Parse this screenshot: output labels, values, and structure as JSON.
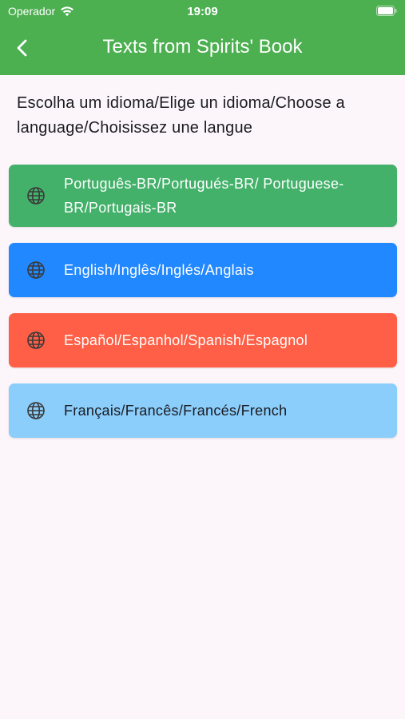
{
  "status_bar": {
    "carrier": "Operador",
    "time": "19:09"
  },
  "app_bar": {
    "title": "Texts from Spirits' Book",
    "back_icon": "chevron-left-icon"
  },
  "prompt": "Escolha um idioma/Elige un idioma/Choose a language/Choisissez une langue",
  "languages": [
    {
      "label": "Português-BR/Portugués-BR/ Portuguese-BR/Portugais-BR",
      "icon": "globe-icon",
      "color": "#43b16a",
      "text_color": "#ffffff"
    },
    {
      "label": "English/Inglês/Inglés/Anglais",
      "icon": "globe-icon",
      "color": "#2188ff",
      "text_color": "#ffffff"
    },
    {
      "label": "Español/Espanhol/Spanish/Espagnol",
      "icon": "globe-icon",
      "color": "#fe5f46",
      "text_color": "#ffffff"
    },
    {
      "label": "Français/Francês/Francés/French",
      "icon": "globe-icon",
      "color": "#8bcdfb",
      "text_color": "#1b1b1f"
    }
  ],
  "colors": {
    "app_bar": "#4caf50",
    "background": "#fcf6fb"
  }
}
